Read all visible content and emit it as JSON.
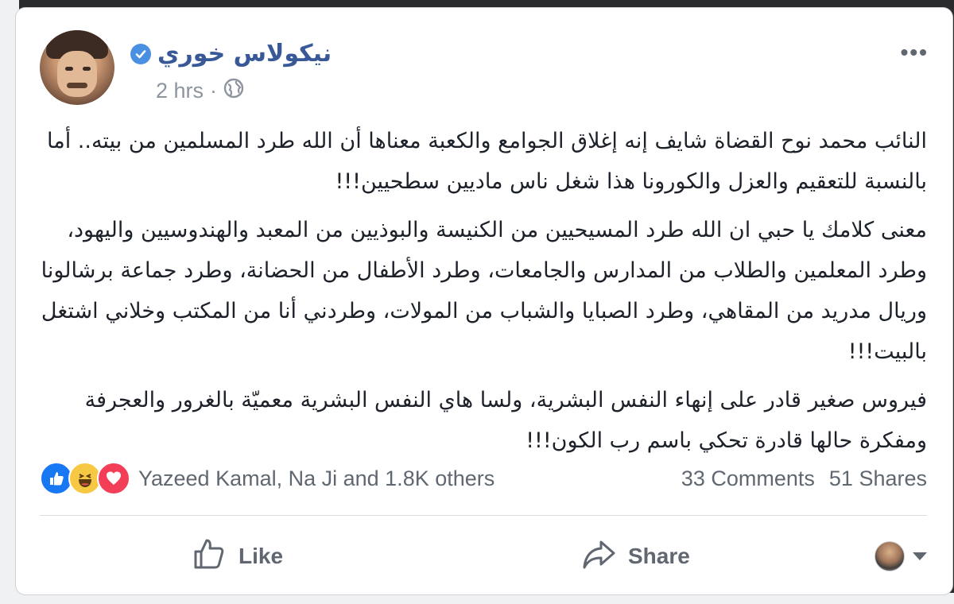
{
  "post": {
    "author_name": "نيكولاس خوري",
    "time": "2 hrs",
    "separator": "·",
    "more_menu": "•••",
    "paragraphs": [
      "النائب محمد نوح القضاة شايف إنه إغلاق الجوامع والكعبة معناها أن الله طرد المسلمين من بيته.. أما بالنسبة للتعقيم والعزل والكورونا هذا شغل ناس ماديين سطحيين!!!",
      "معنى كلامك يا حبي ان الله طرد المسيحيين من الكنيسة والبوذيين من المعبد والهندوسيين واليهود، وطرد المعلمين والطلاب من المدارس والجامعات، وطرد الأطفال من الحضانة، وطرد جماعة برشالونا وريال مدريد من المقاهي، وطرد الصبايا والشباب من المولات، وطردني أنا من المكتب وخلاني اشتغل بالبيت!!!",
      "فيروس صغير قادر على إنهاء النفس البشرية، ولسا هاي النفس البشرية معميّة بالغرور والعجرفة ومفكرة حالها قادرة تحكي باسم رب الكون!!!"
    ]
  },
  "reactions": {
    "icons": [
      "like-icon",
      "haha-icon",
      "love-icon"
    ],
    "names": "Yazeed Kamal, Na Ji and 1.8K others",
    "comments": "33 Comments",
    "shares": "51 Shares"
  },
  "actions": {
    "like_label": "Like",
    "share_label": "Share"
  },
  "colors": {
    "author": "#385898",
    "verified": "#4a90e2",
    "like_blue": "#1877f2",
    "haha_yellow": "#f7c844",
    "love_red": "#f33e58"
  }
}
